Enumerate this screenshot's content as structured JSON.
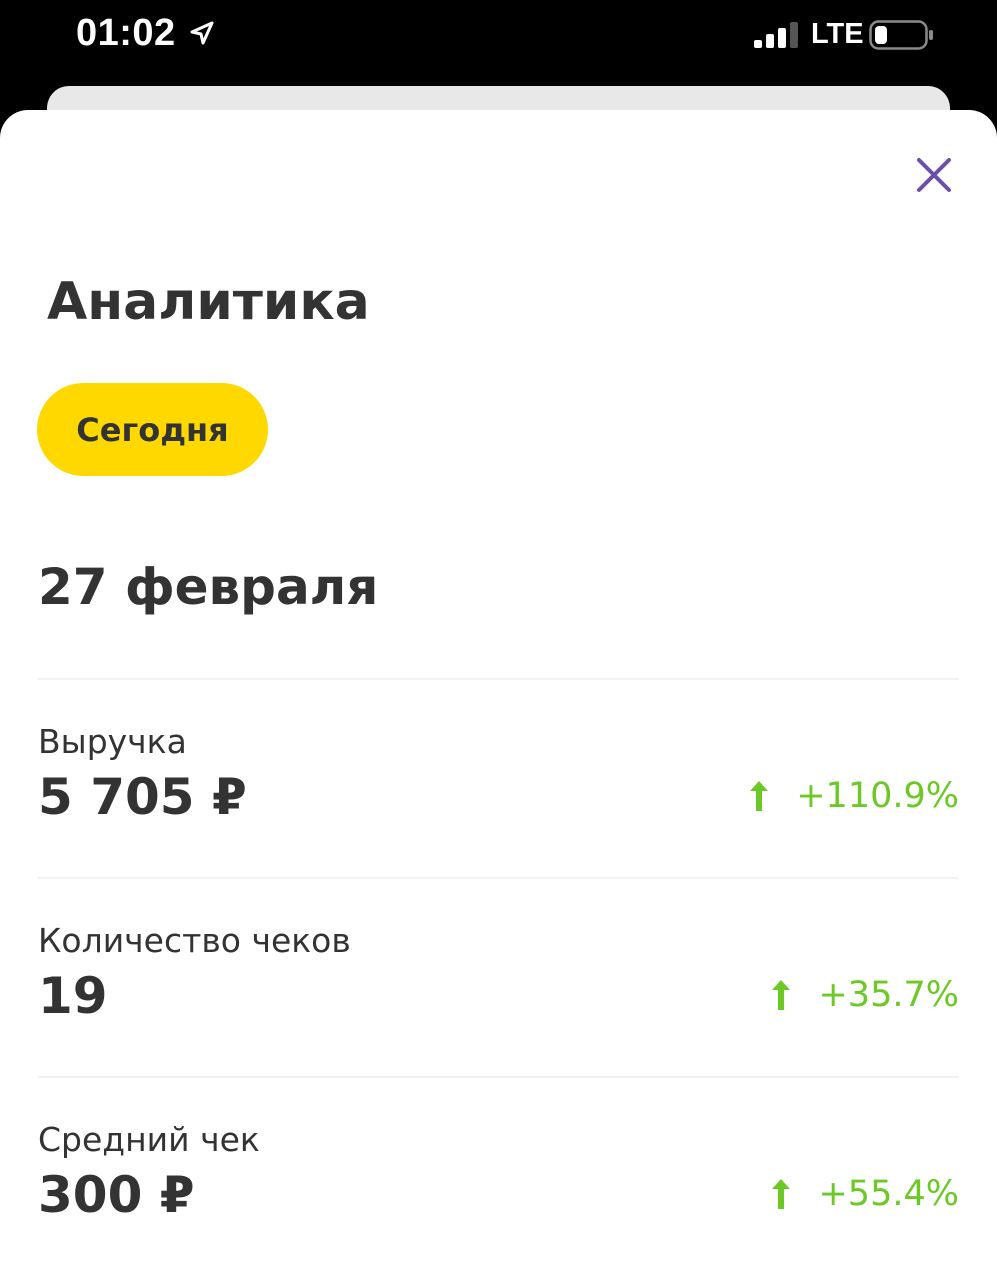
{
  "status_bar": {
    "time": "01:02",
    "network": "LTE",
    "icons": [
      "location-arrow-icon",
      "signal-icon",
      "battery-icon"
    ]
  },
  "header": {
    "close_icon": "close-icon",
    "title": "Аналитика"
  },
  "period": {
    "selected_label": "Сегодня"
  },
  "date": "27 февраля",
  "metrics": [
    {
      "label": "Выручка",
      "value": "5 705 ₽",
      "change": "+110.9%",
      "trend": "up"
    },
    {
      "label": "Количество чеков",
      "value": "19",
      "change": "+35.7%",
      "trend": "up"
    },
    {
      "label": "Средний чек",
      "value": "300 ₽",
      "change": "+55.4%",
      "trend": "up"
    }
  ],
  "colors": {
    "accent_yellow": "#ffd800",
    "positive_green": "#6cc925",
    "close_purple": "#6b4fa8",
    "text_dark": "#333333"
  }
}
